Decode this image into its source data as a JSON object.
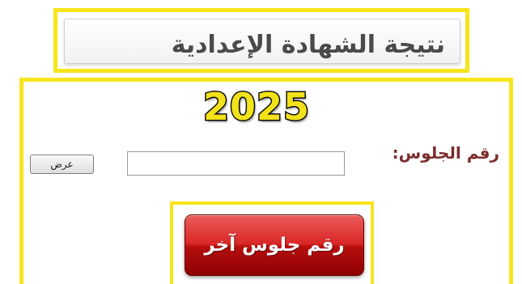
{
  "header": {
    "title": "نتيجة الشهادة الإعدادية"
  },
  "main": {
    "year": "2025",
    "seat_label": "رقم الجلوس:",
    "seat_input": {
      "value": "",
      "placeholder": ""
    },
    "show_button_label": "عرض",
    "other_seat_button_label": "رقم جلوس آخر"
  },
  "colors": {
    "frame_highlight": "#f7e51c",
    "year_fill": "#f3e21a",
    "label_color": "#7b2d2d",
    "primary_button": "#d92626"
  }
}
